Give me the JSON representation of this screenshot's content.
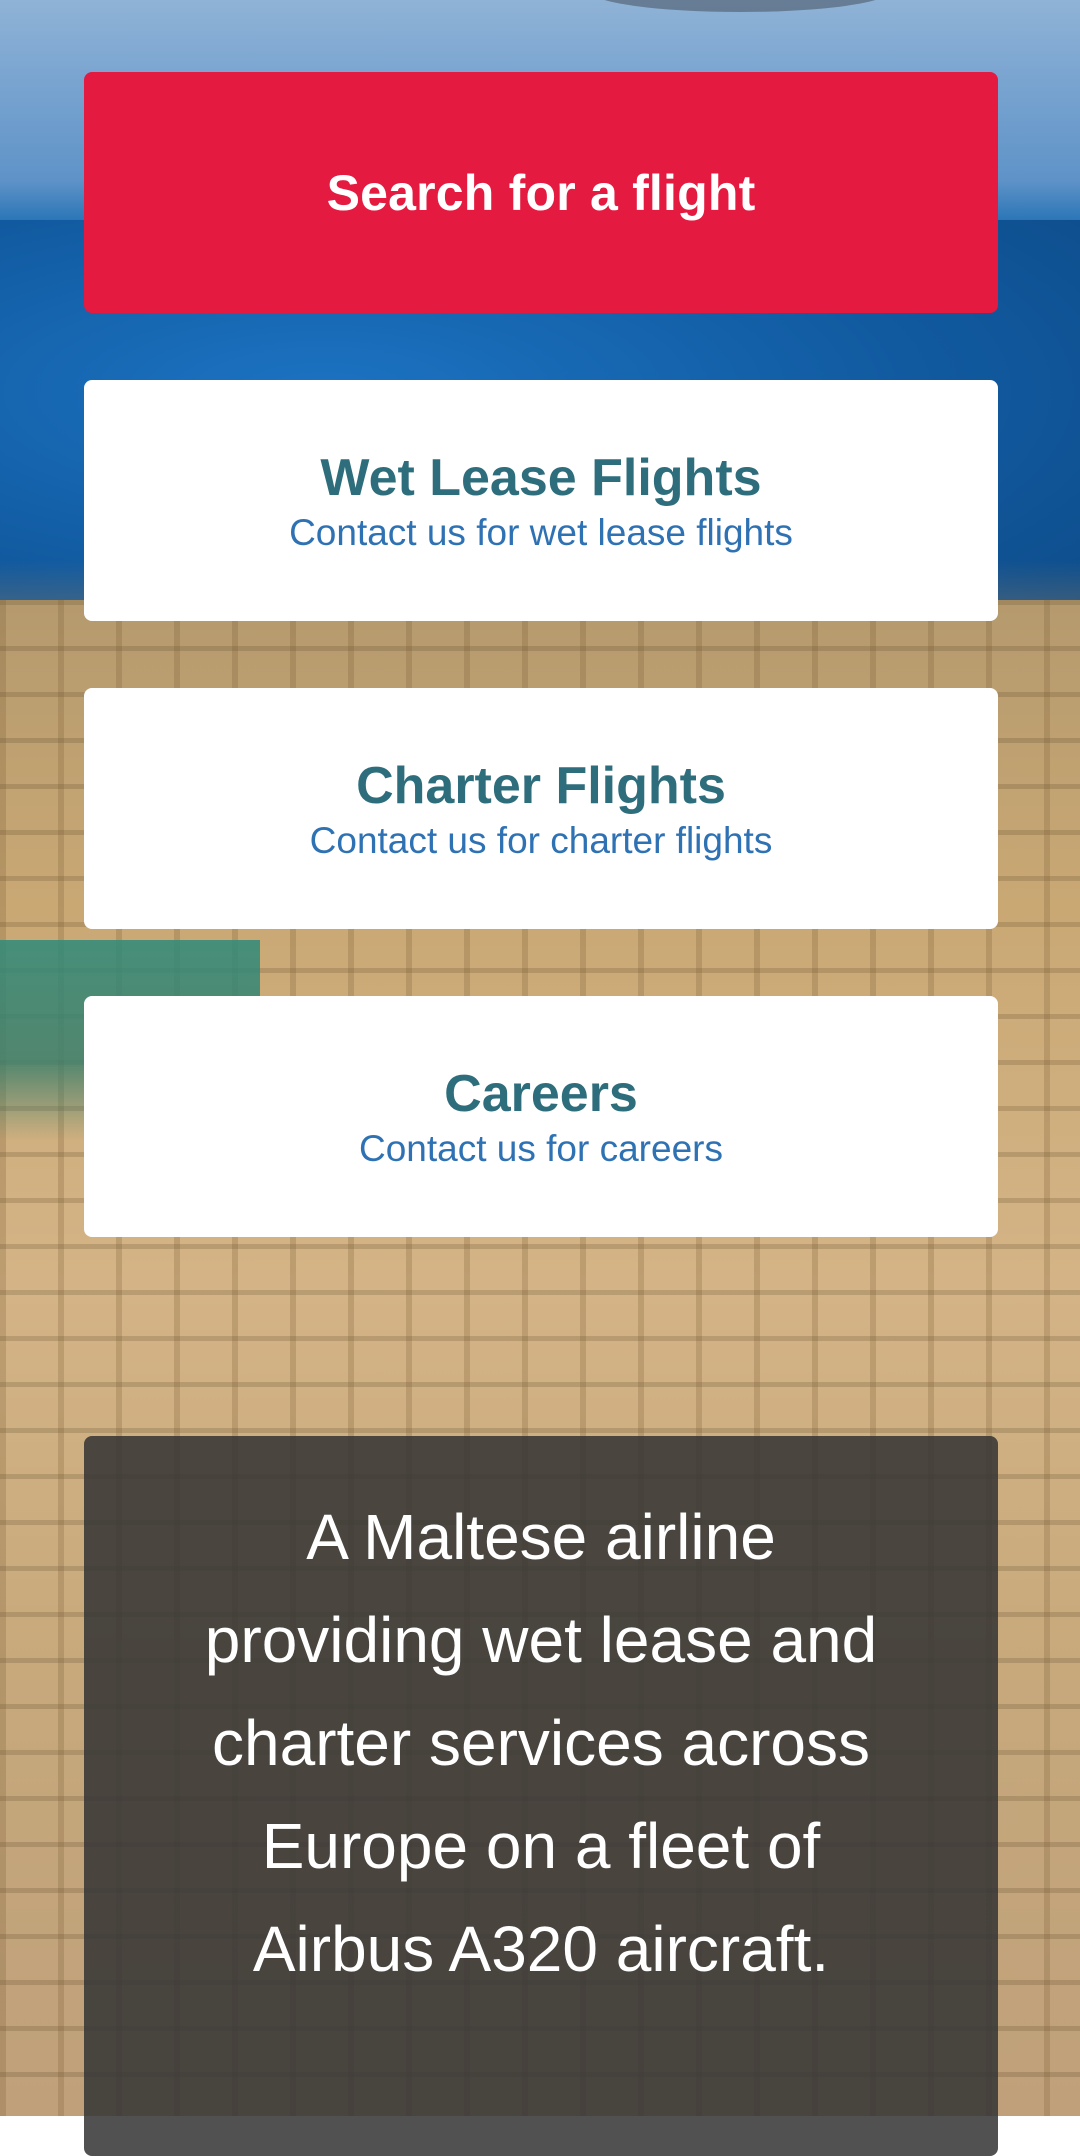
{
  "search": {
    "label": "Search for a flight"
  },
  "links": [
    {
      "title": "Wet Lease Flights",
      "subtitle": "Contact us for wet lease flights"
    },
    {
      "title": "Charter Flights",
      "subtitle": "Contact us for charter flights"
    },
    {
      "title": "Careers",
      "subtitle": "Contact us for careers"
    }
  ],
  "about": {
    "text": "A Maltese airline providing wet lease and charter services across Europe on a fleet of Airbus A320 aircraft."
  },
  "colors": {
    "primary_red": "#e41a40",
    "title_teal": "#2e6e7c",
    "link_blue": "#2f72b4",
    "overlay_dark": "#343434"
  }
}
